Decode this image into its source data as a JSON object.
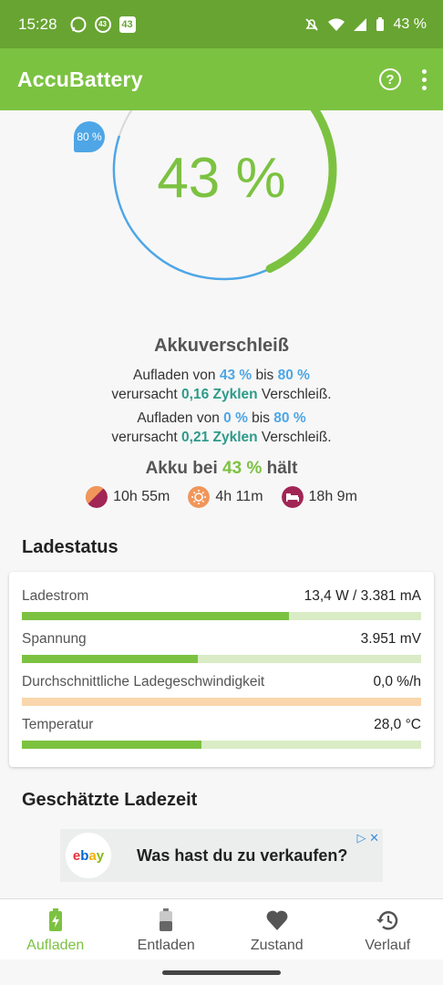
{
  "status_bar": {
    "time": "15:28",
    "chip1": "43",
    "chip2": "43",
    "battery": "43 %"
  },
  "app": {
    "title": "AccuBattery"
  },
  "gauge": {
    "percent_text": "43 %",
    "target_badge": "80 %",
    "charge_level": 0.43,
    "target_level": 0.8
  },
  "wear": {
    "title": "Akkuverschleiß",
    "l1": {
      "a": "Aufladen von ",
      "from": "43 %",
      "b": " bis ",
      "to": "80 %"
    },
    "l2": {
      "a": "verursacht ",
      "cycles": "0,16 Zyklen",
      "b": " Verschleiß."
    },
    "l3": {
      "a": "Aufladen von ",
      "from": "0 %",
      "b": " bis ",
      "to": "80 %"
    },
    "l4": {
      "a": "verursacht ",
      "cycles": "0,21 Zyklen",
      "b": " Verschleiß."
    }
  },
  "hold": {
    "a": "Akku bei ",
    "pct": "43 %",
    "b": " hält"
  },
  "estimates": [
    {
      "icon": "screen-on-icon",
      "value": "10h 55m"
    },
    {
      "icon": "sun-icon",
      "value": "4h 11m"
    },
    {
      "icon": "sleep-icon",
      "value": "18h 9m"
    }
  ],
  "ladestatus": {
    "title": "Ladestatus",
    "rows": [
      {
        "label": "Ladestrom",
        "value": "13,4 W / 3.381 mA",
        "level": 0.67
      },
      {
        "label": "Spannung",
        "value": "3.951 mV",
        "level": 0.44
      },
      {
        "label": "Durchschnittliche Ladegeschwindigkeit",
        "value": "0,0 %/h",
        "level": 0
      },
      {
        "label": "Temperatur",
        "value": "28,0 °C",
        "level": 0.45
      }
    ]
  },
  "charge_time": {
    "title": "Geschätzte Ladezeit"
  },
  "ad": {
    "logo": "ebay",
    "text": "Was hast du zu verkaufen?"
  },
  "nav": [
    {
      "label": "Aufladen",
      "icon": "charging-battery-icon"
    },
    {
      "label": "Entladen",
      "icon": "battery-icon"
    },
    {
      "label": "Zustand",
      "icon": "heart-icon"
    },
    {
      "label": "Verlauf",
      "icon": "history-icon"
    }
  ],
  "colors": {
    "green": "#7cc241",
    "dark_green": "#68a432",
    "blue": "#4ea6e6",
    "teal": "#2e9a8a"
  }
}
